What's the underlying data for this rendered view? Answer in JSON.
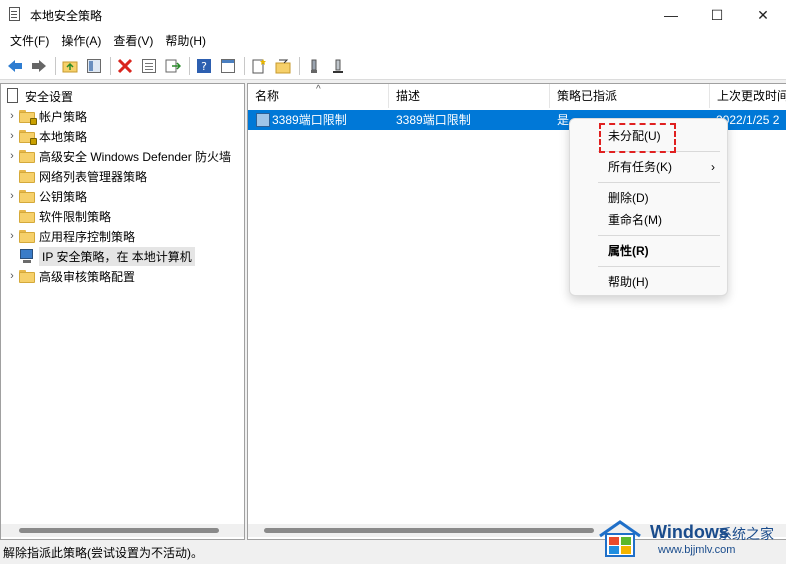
{
  "window": {
    "title": "本地安全策略",
    "controls": {
      "minimize": "—",
      "maximize": "☐",
      "close": "✕"
    }
  },
  "menubar": [
    {
      "label": "文件(F)"
    },
    {
      "label": "操作(A)"
    },
    {
      "label": "查看(V)"
    },
    {
      "label": "帮助(H)"
    }
  ],
  "toolbar": {
    "icons": [
      "back-arrow-icon",
      "forward-arrow-icon",
      "up-folder-icon",
      "show-hide-tree-icon",
      "delete-icon",
      "properties-icon",
      "export-list-icon",
      "help-icon",
      "console-icon",
      "new-policy-icon",
      "manage-filters-icon",
      "assign-icon",
      "unassign-icon"
    ],
    "colors": {
      "back": "#2e7dd1",
      "forward": "#666666",
      "delete": "#d9251d",
      "help": "#2d5fb0"
    }
  },
  "tree": {
    "root": "安全设置",
    "items": [
      {
        "label": "帐户策略",
        "expandable": true,
        "locked": true
      },
      {
        "label": "本地策略",
        "expandable": true,
        "locked": true
      },
      {
        "label": "高级安全 Windows Defender 防火墙",
        "expandable": true,
        "locked": false
      },
      {
        "label": "网络列表管理器策略",
        "expandable": false,
        "locked": false
      },
      {
        "label": "公钥策略",
        "expandable": true,
        "locked": false
      },
      {
        "label": "软件限制策略",
        "expandable": false,
        "locked": false
      },
      {
        "label": "应用程序控制策略",
        "expandable": true,
        "locked": false
      },
      {
        "label": "IP 安全策略，在 本地计算机",
        "expandable": false,
        "locked": false,
        "selected": true
      },
      {
        "label": "高级审核策略配置",
        "expandable": true,
        "locked": false
      }
    ]
  },
  "list": {
    "columns": [
      "名称",
      "描述",
      "策略已指派",
      "上次更改时间"
    ],
    "sort_indicator": "^",
    "rows": [
      {
        "name": "3389端口限制",
        "description": "3389端口限制",
        "assigned": "是",
        "modified": "2022/1/25 2"
      }
    ],
    "selection_color": "#0078d7"
  },
  "context_menu": {
    "items": [
      {
        "label": "未分配(U)"
      },
      {
        "label": "所有任务(K)",
        "submenu": true
      },
      {
        "label": "删除(D)"
      },
      {
        "label": "重命名(M)"
      },
      {
        "label": "属性(R)",
        "bold": true
      },
      {
        "label": "帮助(H)"
      }
    ],
    "chevron": "›",
    "highlight_color": "#e02020"
  },
  "statusbar": {
    "text": "解除指派此策略(尝试设置为不活动)。"
  },
  "watermark": {
    "title": "Windows",
    "subtitle": "系统之家",
    "url": "www.bjjmlv.com"
  }
}
